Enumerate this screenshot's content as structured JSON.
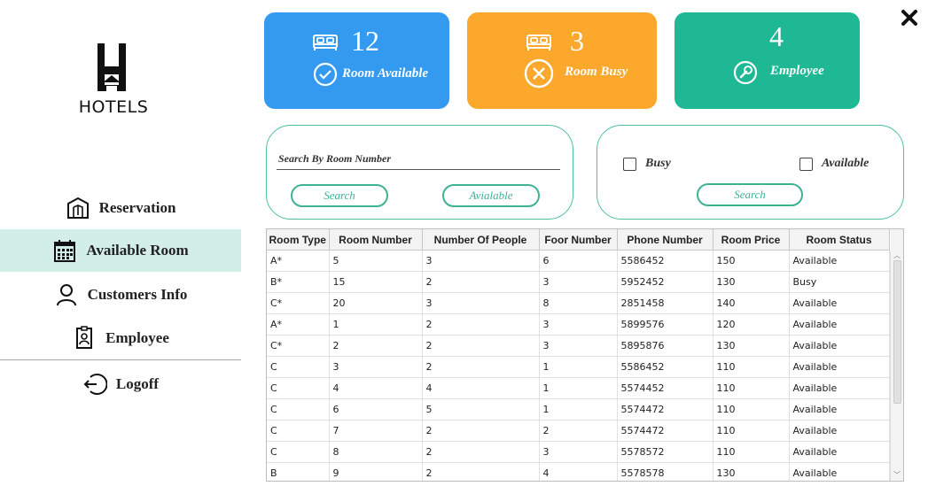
{
  "brand": {
    "logo_text": "HOTELS"
  },
  "sidebar": {
    "items": [
      {
        "label": "Reservation",
        "icon": "house-map-icon"
      },
      {
        "label": "Available Room",
        "icon": "calendar-icon"
      },
      {
        "label": "Customers Info",
        "icon": "user-icon"
      },
      {
        "label": "Employee",
        "icon": "id-badge-icon"
      },
      {
        "label": "Logoff",
        "icon": "logout-icon"
      }
    ],
    "active_index": 1
  },
  "stats": {
    "available": {
      "value": "12",
      "label": "Room Available",
      "color": "#339af0"
    },
    "busy": {
      "value": "3",
      "label": "Room Busy",
      "color": "#fba82d"
    },
    "employee": {
      "value": "4",
      "label": "Employee",
      "color": "#1eb894"
    }
  },
  "search_panel": {
    "label": "Search By Room Number",
    "search_button": "Search",
    "available_button": "Avialable"
  },
  "filter_panel": {
    "busy_label": "Busy",
    "available_label": "Available",
    "search_button": "Search"
  },
  "table": {
    "columns": [
      "Room Type",
      "Room Number",
      "Number Of People",
      "Foor Number",
      "Phone Number",
      "Room Price",
      "Room Status"
    ],
    "rows": [
      [
        "A*",
        "5",
        "3",
        "6",
        "5586452",
        "150",
        "Available"
      ],
      [
        "B*",
        "15",
        "2",
        "3",
        "5952452",
        "130",
        "Busy"
      ],
      [
        "C*",
        "20",
        "3",
        "8",
        "2851458",
        "140",
        "Available"
      ],
      [
        "A*",
        "1",
        "2",
        "3",
        "5899576",
        "120",
        "Available"
      ],
      [
        "C*",
        "2",
        "2",
        "3",
        "5895876",
        "130",
        "Available"
      ],
      [
        "C",
        "3",
        "2",
        "1",
        "5586452",
        "110",
        "Available"
      ],
      [
        "C",
        "4",
        "4",
        "1",
        "5574452",
        "110",
        "Available"
      ],
      [
        "C",
        "6",
        "5",
        "1",
        "5574472",
        "110",
        "Available"
      ],
      [
        "C",
        "7",
        "2",
        "2",
        "5574472",
        "110",
        "Available"
      ],
      [
        "C",
        "8",
        "2",
        "3",
        "5578572",
        "110",
        "Available"
      ],
      [
        "B",
        "9",
        "2",
        "4",
        "5578578",
        "130",
        "Available"
      ]
    ]
  }
}
